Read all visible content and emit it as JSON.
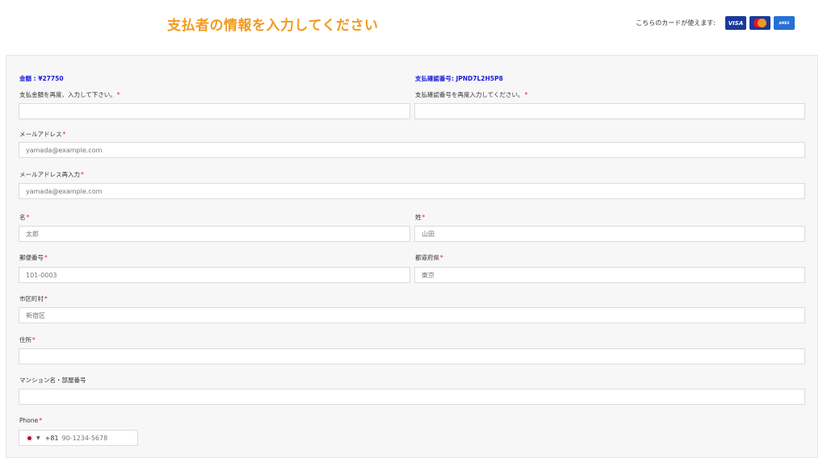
{
  "header": {
    "title": "支払者の情報を入力してください",
    "cards_label": "こちらのカードが使えます:",
    "cards": [
      {
        "name": "visa",
        "label": "VISA",
        "color": "#1a3a9a"
      },
      {
        "name": "mastercard",
        "label": "",
        "color": "#1a3a9a"
      },
      {
        "name": "amex",
        "label": "AMEX",
        "color": "#2671d4"
      }
    ]
  },
  "colors": {
    "title": "#f39a1e",
    "info": "#1a1ad8",
    "required": "#e02020"
  },
  "info": {
    "amount_label": "金額 : ¥27750",
    "confirm_label": "支払確認番号: JPND7L2H5P8"
  },
  "fields": {
    "amount": {
      "label": "支払金額を再度、入力して下さい。",
      "required": "*",
      "value": "",
      "placeholder": ""
    },
    "confirm": {
      "label": "支払確認番号を再度入力してください。",
      "required": "*",
      "value": "",
      "placeholder": ""
    },
    "email": {
      "label": "メールアドレス",
      "required": "*",
      "placeholder": "yamada@example.com"
    },
    "email_confirm": {
      "label": "メールアドレス再入力",
      "required": "*",
      "placeholder": "yamada@example.com"
    },
    "first_name": {
      "label": "名",
      "required": "*",
      "placeholder": "太郎"
    },
    "last_name": {
      "label": "姓",
      "required": "*",
      "placeholder": "山田"
    },
    "postal": {
      "label": "郵便番号",
      "required": "*",
      "placeholder": "101-0003"
    },
    "prefecture": {
      "label": "都道府県",
      "required": "*",
      "placeholder": "東京"
    },
    "city": {
      "label": "市区町村",
      "required": "*",
      "placeholder": "新宿区"
    },
    "address": {
      "label": "住所",
      "required": "*",
      "placeholder": ""
    },
    "building": {
      "label": "マンション名・部屋番号",
      "required": "",
      "placeholder": ""
    },
    "phone": {
      "label": "Phone",
      "required": "*",
      "dial_code": "+81",
      "placeholder": "90-1234-5678",
      "country_flag": "jp-flag-icon"
    }
  }
}
